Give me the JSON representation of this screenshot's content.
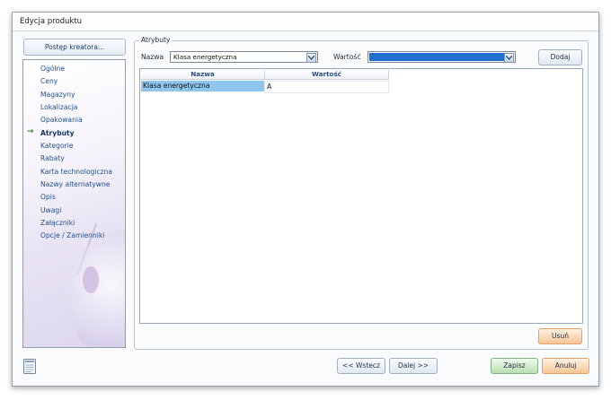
{
  "window": {
    "title": "Edycja produktu"
  },
  "wizard": {
    "progress_button": "Postęp kreatora...",
    "items": [
      {
        "label": "Ogólne",
        "active": false
      },
      {
        "label": "Ceny",
        "active": false
      },
      {
        "label": "Magazyny",
        "active": false
      },
      {
        "label": "Lokalizacja",
        "active": false
      },
      {
        "label": "Opakowania",
        "active": false
      },
      {
        "label": "Atrybuty",
        "active": true
      },
      {
        "label": "Kategorie",
        "active": false
      },
      {
        "label": "Rabaty",
        "active": false
      },
      {
        "label": "Karta technologiczna",
        "active": false
      },
      {
        "label": "Nazwy alternatywne",
        "active": false
      },
      {
        "label": "Opis",
        "active": false
      },
      {
        "label": "Uwagi",
        "active": false
      },
      {
        "label": "Załączniki",
        "active": false
      },
      {
        "label": "Opcje / Zamienniki",
        "active": false
      }
    ],
    "active_marker": "→"
  },
  "attributes": {
    "group_title": "Atrybuty",
    "name_label": "Nazwa",
    "name_value": "Klasa energetyczna",
    "value_label": "Wartość",
    "value_value": "",
    "add_button": "Dodaj",
    "grid": {
      "columns": [
        "Nazwa",
        "Wartość"
      ],
      "rows": [
        {
          "name": "Klasa energetyczna",
          "value": "A"
        }
      ]
    },
    "remove_button": "Usuń"
  },
  "footer": {
    "back_button": "<< Wstecz",
    "next_button": "Dalej >>",
    "save_button": "Zapisz",
    "cancel_button": "Anuluj"
  },
  "colors": {
    "value_combo_fill": "#1e6fd0",
    "selected_cell": "#8ec6f0",
    "active_arrow": "#2a8a2a"
  }
}
